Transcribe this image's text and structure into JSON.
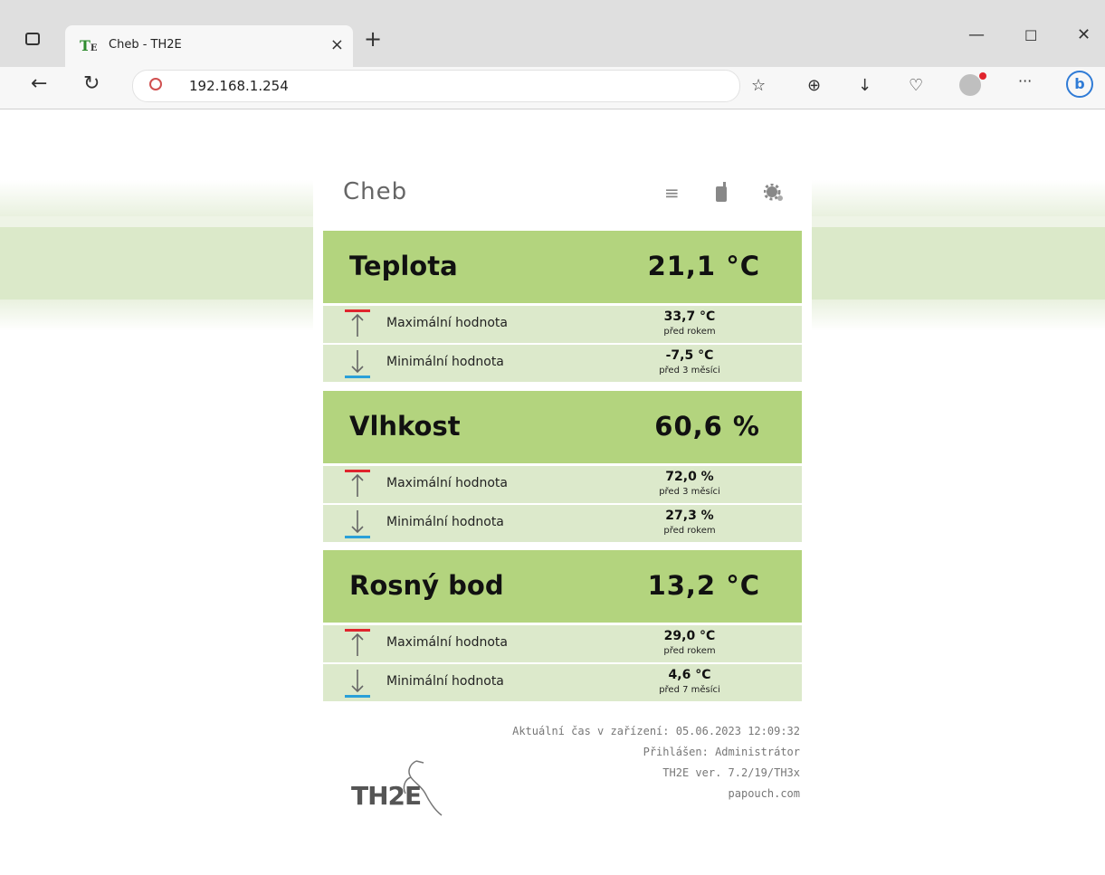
{
  "browser": {
    "tab_title": "Cheb - TH2E",
    "url": "192.168.1.254",
    "new_tab": "+",
    "close_tab": "×",
    "more": "···"
  },
  "colors": {
    "accent_green": "#b3d47e",
    "row_green": "#dce9cb",
    "max_red": "#e0242d",
    "min_blue": "#2aa0d8"
  },
  "page": {
    "title": "Cheb",
    "icons": [
      "menu-icon",
      "mobile-icon",
      "settings-icon"
    ],
    "sections": [
      {
        "name": "Teplota",
        "value": "21,1 °C",
        "rows": [
          {
            "type": "max",
            "label": "Maximální hodnota",
            "value": "33,7 °C",
            "ago": "před rokem"
          },
          {
            "type": "min",
            "label": "Minimální hodnota",
            "value": "-7,5 °C",
            "ago": "před 3 měsíci"
          }
        ]
      },
      {
        "name": "Vlhkost",
        "value": "60,6 %",
        "rows": [
          {
            "type": "max",
            "label": "Maximální hodnota",
            "value": "72,0 %",
            "ago": "před 3 měsíci"
          },
          {
            "type": "min",
            "label": "Minimální hodnota",
            "value": "27,3 %",
            "ago": "před rokem"
          }
        ]
      },
      {
        "name": "Rosný bod",
        "value": "13,2 °C",
        "rows": [
          {
            "type": "max",
            "label": "Maximální hodnota",
            "value": "29,0 °C",
            "ago": "před rokem"
          },
          {
            "type": "min",
            "label": "Minimální hodnota",
            "value": "4,6 °C",
            "ago": "před 7 měsíci"
          }
        ]
      }
    ],
    "footer": {
      "time": "Aktuální čas v zařízení: 05.06.2023 12:09:32",
      "user": "Přihlášen: Administrátor",
      "version": "TH2E ver. 7.2/19/TH3x",
      "site": "papouch.com"
    },
    "logo_text": "TH2E"
  }
}
